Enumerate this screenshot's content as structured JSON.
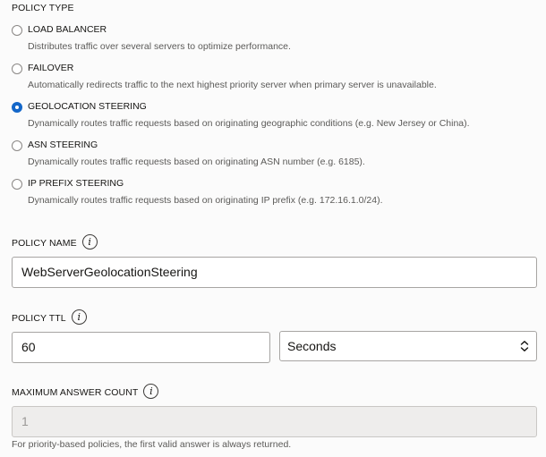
{
  "policy_type": {
    "label": "POLICY TYPE",
    "options": [
      {
        "title": "LOAD BALANCER",
        "description": "Distributes traffic over several servers to optimize performance.",
        "checked": false
      },
      {
        "title": "FAILOVER",
        "description": "Automatically redirects traffic to the next highest priority server when primary server is unavailable.",
        "checked": false
      },
      {
        "title": "GEOLOCATION STEERING",
        "description": "Dynamically routes traffic requests based on originating geographic conditions (e.g. New Jersey or China).",
        "checked": true
      },
      {
        "title": "ASN STEERING",
        "description": "Dynamically routes traffic requests based on originating ASN number (e.g. 6185).",
        "checked": false
      },
      {
        "title": "IP PREFIX STEERING",
        "description": "Dynamically routes traffic requests based on originating IP prefix (e.g. 172.16.1.0/24).",
        "checked": false
      }
    ]
  },
  "policy_name": {
    "label": "POLICY NAME",
    "info_glyph": "i",
    "value": "WebServerGeolocationSteering"
  },
  "policy_ttl": {
    "label": "POLICY TTL",
    "info_glyph": "i",
    "value": "60",
    "unit": "Seconds"
  },
  "max_answer": {
    "label": "MAXIMUM ANSWER COUNT",
    "info_glyph": "i",
    "value": "1",
    "helper": "For priority-based policies, the first valid answer is always returned."
  },
  "colors": {
    "accent": "#1467c9",
    "text": "#161513",
    "muted": "#5b5a58",
    "background": "#fbfbfb"
  }
}
